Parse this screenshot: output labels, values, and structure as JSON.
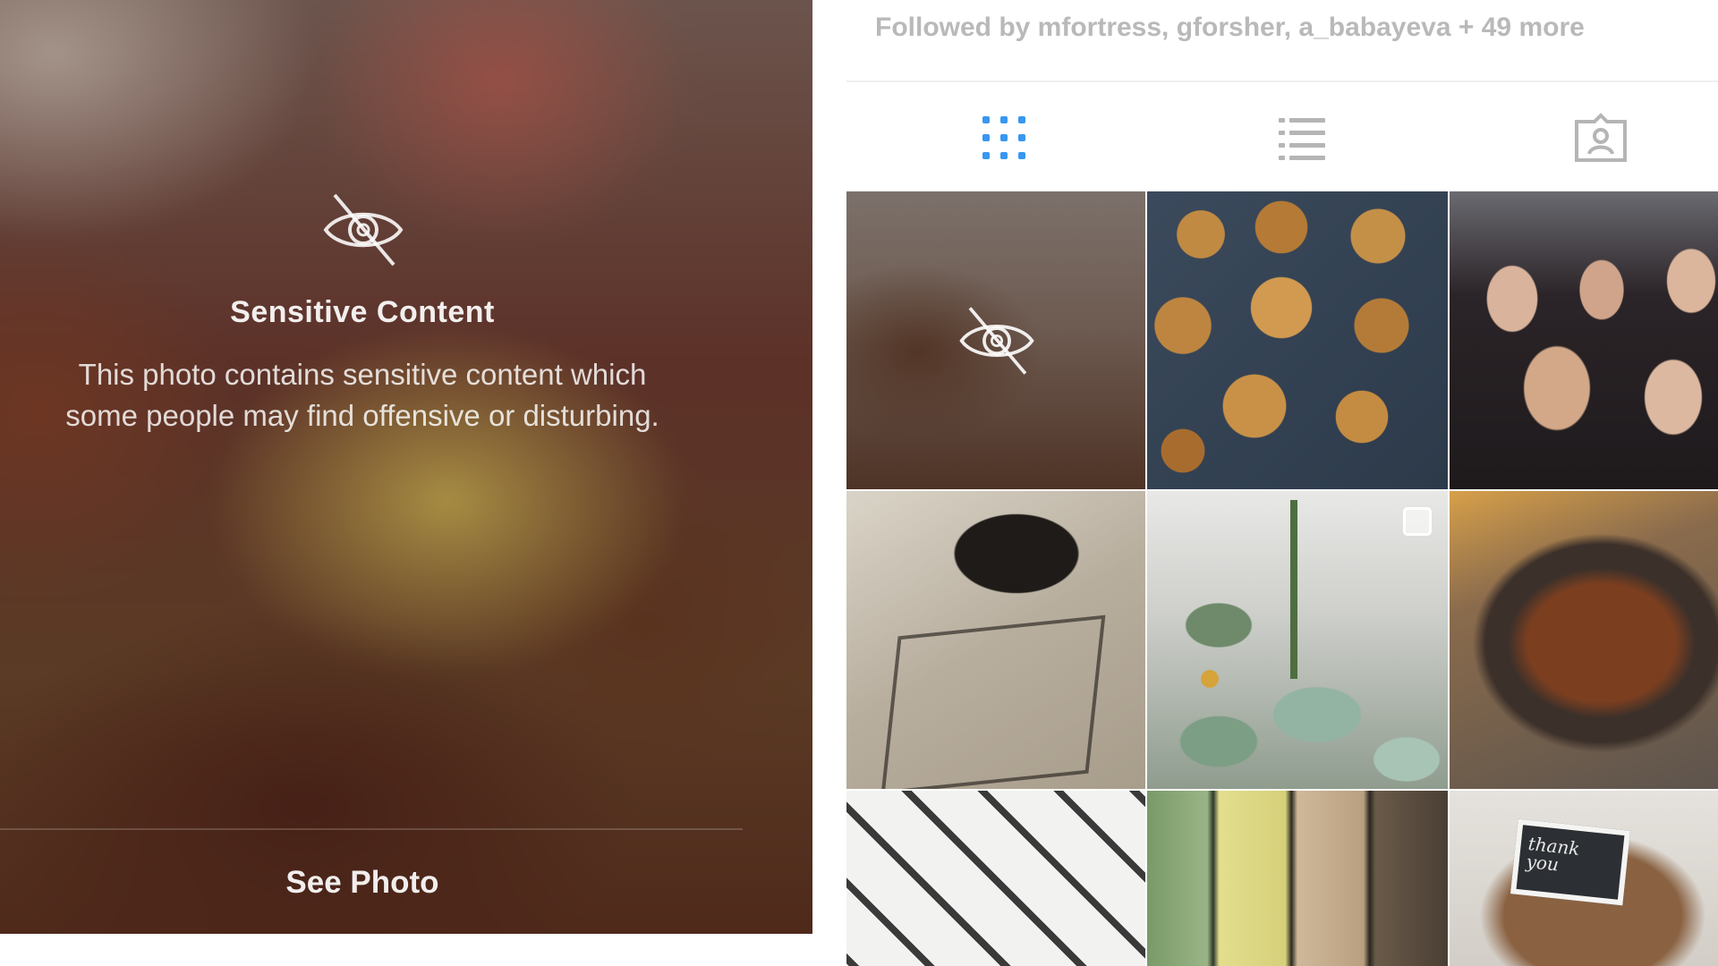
{
  "sensitive_overlay": {
    "icon": "eye-slash-icon",
    "title": "Sensitive Content",
    "description_line1": "This photo contains sensitive content which",
    "description_line2": "some people may find offensive or disturbing.",
    "see_photo_label": "See Photo"
  },
  "profile": {
    "followed_by": "Followed by mfortress, gforsher, a_babayeva + 49 more",
    "tabs": [
      {
        "name": "grid",
        "icon": "grid-icon",
        "active": true
      },
      {
        "name": "list",
        "icon": "list-icon",
        "active": false
      },
      {
        "name": "tagged",
        "icon": "tagged-photos-icon",
        "active": false
      }
    ],
    "accent_color": "#3897f0",
    "inactive_icon_color": "#b5b5b5",
    "grid_tiles": [
      {
        "id": "sensitive",
        "icon": "eye-slash-icon"
      },
      {
        "id": "food-pastries"
      },
      {
        "id": "group-selfie"
      },
      {
        "id": "chair-shadow"
      },
      {
        "id": "succulent-plants",
        "badge": "multi-photo-icon"
      },
      {
        "id": "noodles-bowl"
      },
      {
        "id": "geometric-tiles"
      },
      {
        "id": "layered-bars"
      },
      {
        "id": "card-on-wood",
        "note_text": "thank you"
      }
    ]
  }
}
